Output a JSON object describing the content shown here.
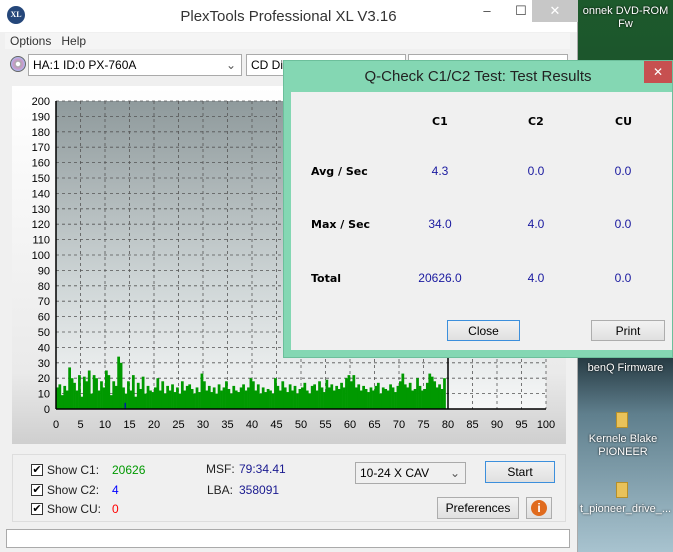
{
  "window": {
    "title": "PlexTools Professional XL V3.16",
    "logo": "XL",
    "minimize": "–",
    "maximize": "☐",
    "close": "✕"
  },
  "menu": [
    "Options",
    "Help"
  ],
  "toolbar": {
    "drive": "HA:1 ID:0  PX-760A",
    "mode": "CD Dia"
  },
  "chart_data": {
    "type": "bar",
    "xlim": [
      0,
      100
    ],
    "ylim": [
      0,
      200
    ],
    "xticks": [
      0,
      5,
      10,
      15,
      20,
      25,
      30,
      35,
      40,
      45,
      50,
      55,
      60,
      65,
      70,
      75,
      80,
      85,
      90,
      95,
      100
    ],
    "yticks": [
      0,
      10,
      20,
      30,
      40,
      50,
      60,
      70,
      80,
      90,
      100,
      110,
      120,
      130,
      140,
      150,
      160,
      170,
      180,
      190,
      200
    ],
    "grid": true,
    "x_step": 0.5,
    "series": [
      {
        "color": "#009900",
        "values": [
          14,
          16,
          9,
          15,
          12,
          27,
          20,
          17,
          12,
          22,
          8,
          21,
          18,
          25,
          10,
          22,
          20,
          12,
          18,
          14,
          25,
          22,
          9,
          18,
          15,
          34,
          30,
          14,
          10,
          18,
          12,
          22,
          8,
          17,
          13,
          21,
          10,
          15,
          12,
          11,
          14,
          20,
          12,
          18,
          10,
          15,
          12,
          16,
          11,
          14,
          10,
          18,
          12,
          15,
          16,
          13,
          10,
          14,
          11,
          23,
          18,
          12,
          15,
          11,
          14,
          10,
          16,
          12,
          14,
          18,
          13,
          10,
          15,
          12,
          11,
          14,
          16,
          12,
          14,
          20,
          18,
          12,
          16,
          10,
          14,
          11,
          13,
          12,
          10,
          20,
          15,
          12,
          18,
          14,
          11,
          16,
          12,
          15,
          10,
          13,
          14,
          17,
          12,
          10,
          15,
          16,
          12,
          18,
          14,
          11,
          19,
          14,
          16,
          12,
          15,
          13,
          17,
          14,
          20,
          22,
          18,
          22,
          14,
          16,
          12,
          15,
          13,
          11,
          14,
          12,
          15,
          17,
          10,
          14,
          13,
          12,
          16,
          14,
          11,
          15,
          18,
          23,
          16,
          14,
          17,
          12,
          13,
          20,
          15,
          12,
          13,
          17,
          23,
          21,
          18,
          14,
          16,
          13,
          20
        ]
      },
      {
        "color": "#0000cc",
        "points": [
          [
            14,
            4
          ]
        ]
      }
    ]
  },
  "controls": {
    "show_c1_label": "Show C1:",
    "c1": "20626",
    "show_c2_label": "Show C2:",
    "c2": "4",
    "show_cu_label": "Show CU:",
    "cu": "0",
    "msf_label": "MSF:",
    "msf": "79:34.41",
    "lba_label": "LBA:",
    "lba": "358091",
    "speed": "10-24 X CAV",
    "start": "Start",
    "preferences": "Preferences",
    "info": "i",
    "colors": {
      "c1": "#009900",
      "c2": "#0000ff",
      "cu": "#ff0000"
    }
  },
  "dialog": {
    "title": "Q-Check C1/C2 Test: Test Results",
    "close_icon": "✕",
    "columns": [
      "C1",
      "C2",
      "CU"
    ],
    "rows": [
      {
        "label": "Avg / Sec",
        "values": [
          "4.3",
          "0.0",
          "0.0"
        ]
      },
      {
        "label": "Max / Sec",
        "values": [
          "34.0",
          "4.0",
          "0.0"
        ]
      },
      {
        "label": "Total",
        "values": [
          "20626.0",
          "4.0",
          "0.0"
        ]
      }
    ],
    "close": "Close",
    "print": "Print"
  },
  "desktop": {
    "icon1": "onnek DVD-ROM Fw",
    "icon2": "benQ Firmware",
    "icon3": "Kernele Blake PIONEER",
    "icon4": "t_pioneer_drive_..."
  }
}
